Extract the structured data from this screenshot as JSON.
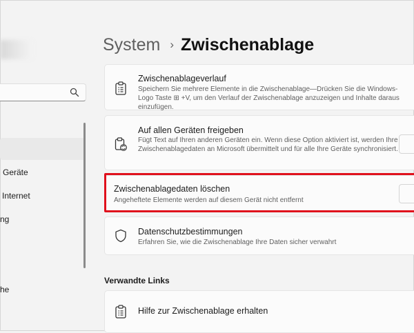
{
  "sidebar": {
    "search_placeholder": "",
    "items": [
      {
        "label": "Geräte"
      },
      {
        "label": "Internet"
      },
      {
        "label": "ng"
      },
      {
        "label": "he"
      }
    ]
  },
  "header": {
    "root": "System",
    "separator": "›",
    "current": "Zwischenablage"
  },
  "cards": {
    "history": {
      "title": "Zwischenablageverlauf",
      "description": "Speichern Sie mehrere Elemente in die Zwischenablage—Drücken Sie die Windows-Logo Taste ⊞ +V, um den Verlauf der Zwischenablage anzuzeigen und Inhalte daraus einzufügen."
    },
    "share": {
      "title": "Auf allen Geräten freigeben",
      "description": "Fügt Text auf Ihren anderen Geräten ein. Wenn diese Option aktiviert ist, werden Ihre Zwischenablagedaten an Microsoft übermittelt und für alle Ihre Geräte synchronisiert."
    },
    "clear": {
      "title": "Zwischenablagedaten löschen",
      "description": "Angeheftete Elemente werden auf diesem Gerät nicht entfernt"
    },
    "privacy": {
      "title": "Datenschutzbestimmungen",
      "description": "Erfahren Sie, wie die Zwischenablage Ihre Daten sicher verwahrt"
    }
  },
  "related": {
    "heading": "Verwandte Links",
    "help_title": "Hilfe zur Zwischenablage erhalten"
  },
  "icons": {
    "search": "search-icon",
    "clipboard": "clipboard-icon",
    "clipboard_sync": "clipboard-sync-icon",
    "shield": "shield-icon"
  },
  "colors": {
    "highlight": "#e0101c",
    "background": "#f3f3f3",
    "card": "#fbfbfb"
  }
}
